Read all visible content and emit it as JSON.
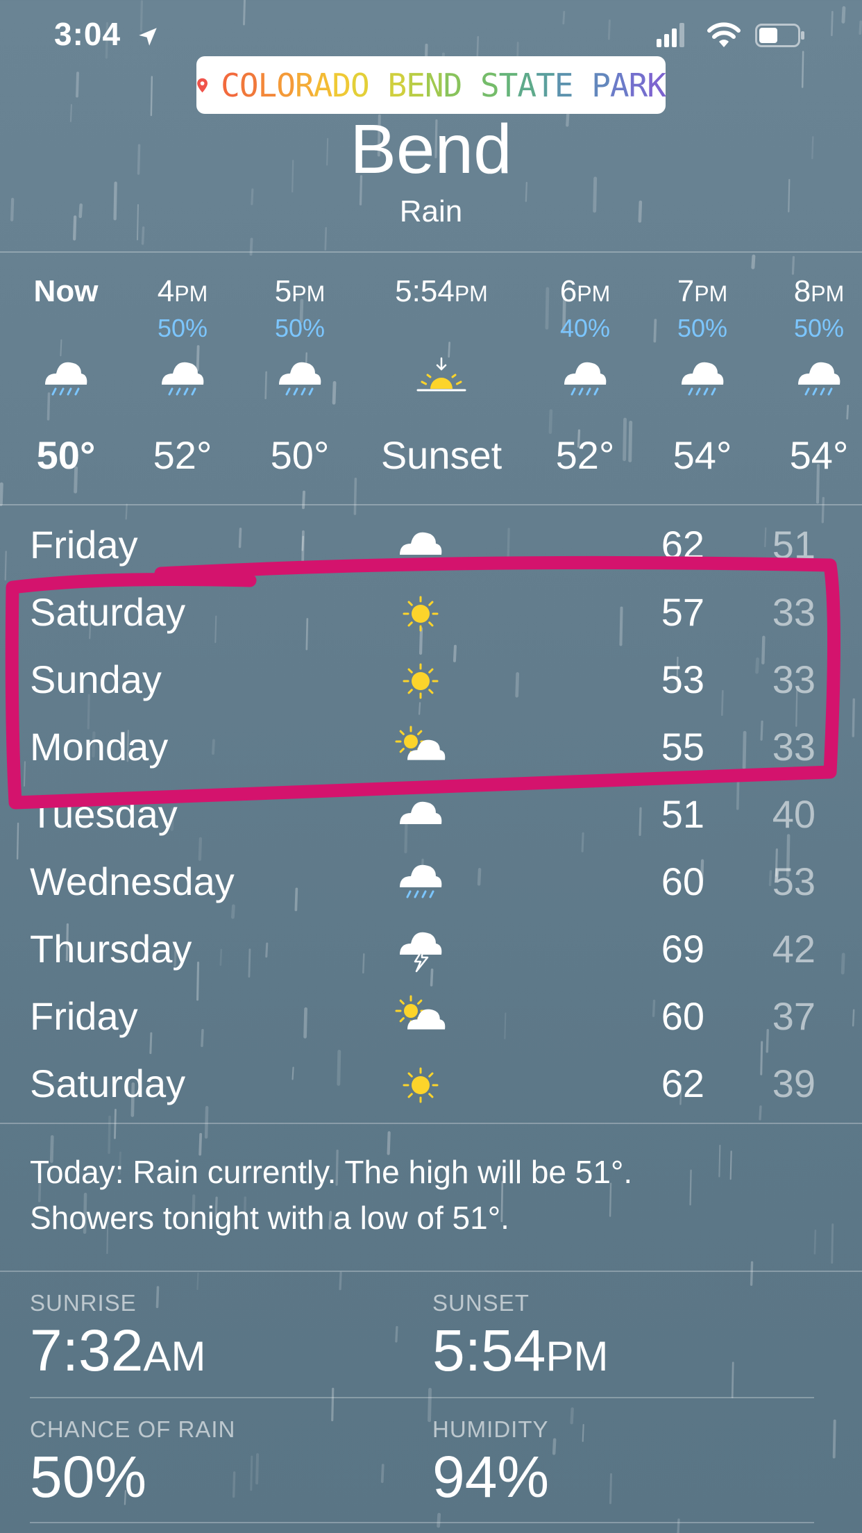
{
  "status_bar": {
    "time": "3:04"
  },
  "sticker": {
    "text": "COLORADO BEND STATE PARK",
    "letter_colors": [
      "#f26a3d",
      "#f0783a",
      "#f3883a",
      "#f49a38",
      "#f4ab36",
      "#f3bb34",
      "#efc935",
      "#e3cf38",
      "#cfcf3e",
      "#b9cd45",
      "#a1c94f",
      "#89c35c",
      "#75bc6a",
      "#66b47a",
      "#5eaa8b",
      "#5b9f9d",
      "#5d93ae",
      "#6387bd",
      "#6b7bc8",
      "#746fcd",
      "#7d64cf",
      "#8559cf",
      "#8c50cc",
      "#9248c8"
    ]
  },
  "location": {
    "city": "Bend",
    "condition": "Rain"
  },
  "hourly": [
    {
      "label": "Now",
      "pop": "",
      "temp": "50°",
      "icon": "rain-cloud-icon",
      "bold": true
    },
    {
      "label": "4",
      "suffix": "PM",
      "pop": "50%",
      "temp": "52°",
      "icon": "rain-cloud-icon"
    },
    {
      "label": "5",
      "suffix": "PM",
      "pop": "50%",
      "temp": "50°",
      "icon": "rain-cloud-icon"
    },
    {
      "label": "5:54",
      "suffix": "PM",
      "pop": "",
      "temp": "Sunset",
      "icon": "sunset-icon"
    },
    {
      "label": "6",
      "suffix": "PM",
      "pop": "40%",
      "temp": "52°",
      "icon": "rain-cloud-icon"
    },
    {
      "label": "7",
      "suffix": "PM",
      "pop": "50%",
      "temp": "54°",
      "icon": "rain-cloud-icon"
    },
    {
      "label": "8",
      "suffix": "PM",
      "pop": "50%",
      "temp": "54°",
      "icon": "rain-cloud-icon"
    }
  ],
  "daily": [
    {
      "day": "Friday",
      "icon": "cloud-icon",
      "high": "62",
      "low": "51"
    },
    {
      "day": "Saturday",
      "icon": "sun-icon",
      "high": "57",
      "low": "33"
    },
    {
      "day": "Sunday",
      "icon": "sun-icon",
      "high": "53",
      "low": "33"
    },
    {
      "day": "Monday",
      "icon": "partly-cloudy-icon",
      "high": "55",
      "low": "33"
    },
    {
      "day": "Tuesday",
      "icon": "cloud-icon",
      "high": "51",
      "low": "40"
    },
    {
      "day": "Wednesday",
      "icon": "rain-cloud-icon",
      "high": "60",
      "low": "53"
    },
    {
      "day": "Thursday",
      "icon": "thunderstorm-icon",
      "high": "69",
      "low": "42"
    },
    {
      "day": "Friday",
      "icon": "partly-cloudy-icon",
      "high": "60",
      "low": "37"
    },
    {
      "day": "Saturday",
      "icon": "sun-icon",
      "high": "62",
      "low": "39"
    }
  ],
  "summary": {
    "line1": "Today: Rain currently. The high will be 51°.",
    "line2": "Showers tonight with a low of 51°."
  },
  "details": {
    "sunrise_label": "SUNRISE",
    "sunrise_value": "7:32",
    "sunrise_suffix": "AM",
    "sunset_label": "SUNSET",
    "sunset_value": "5:54",
    "sunset_suffix": "PM",
    "rain_label": "CHANCE OF RAIN",
    "rain_value": "50%",
    "humidity_label": "HUMIDITY",
    "humidity_value": "94%"
  },
  "colors": {
    "highlight": "#d4136d",
    "precip": "#7cc6ff",
    "sun": "#fcd42b"
  }
}
